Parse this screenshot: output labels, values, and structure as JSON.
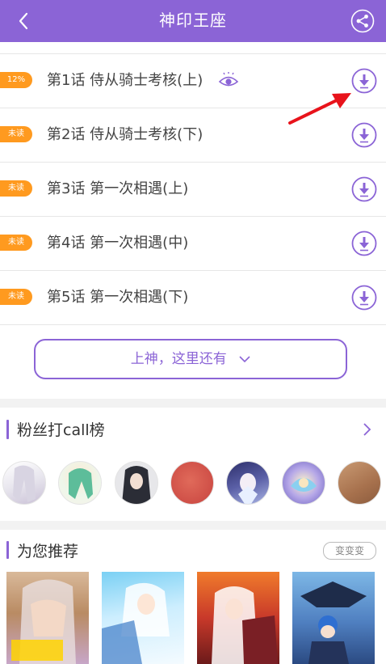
{
  "header": {
    "title": "神印王座"
  },
  "chapters": [
    {
      "badge": "12%",
      "title": "第1话 侍从骑士考核(上)",
      "viewed": true
    },
    {
      "badge": "未读",
      "title": "第2话 侍从骑士考核(下)"
    },
    {
      "badge": "未读",
      "title": "第3话 第一次相遇(上)"
    },
    {
      "badge": "未读",
      "title": "第4话 第一次相遇(中)"
    },
    {
      "badge": "未读",
      "title": "第5话 第一次相遇(下)"
    }
  ],
  "more_button": {
    "label": "上神，这里还有"
  },
  "fans": {
    "title": "粉丝打call榜"
  },
  "recommend": {
    "title": "为您推荐",
    "change_label": "变变变"
  },
  "colors": {
    "accent": "#8b64d6",
    "badge": "#ff9a1f",
    "annotation_arrow": "#e8131b"
  },
  "icons": [
    "back-icon",
    "share-icon",
    "eye-icon",
    "download-icon",
    "chevron-down-icon",
    "chevron-right-icon"
  ]
}
